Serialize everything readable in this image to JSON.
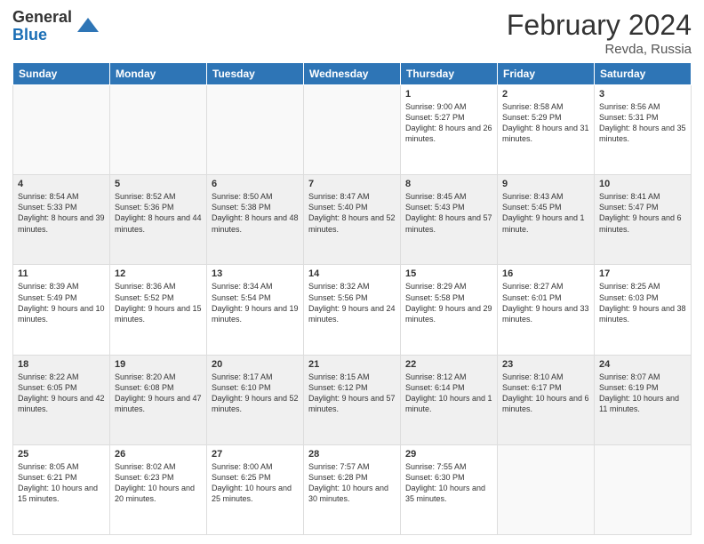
{
  "header": {
    "logo_general": "General",
    "logo_blue": "Blue",
    "month_year": "February 2024",
    "location": "Revda, Russia"
  },
  "days_of_week": [
    "Sunday",
    "Monday",
    "Tuesday",
    "Wednesday",
    "Thursday",
    "Friday",
    "Saturday"
  ],
  "weeks": [
    [
      {
        "day": "",
        "empty": true
      },
      {
        "day": "",
        "empty": true
      },
      {
        "day": "",
        "empty": true
      },
      {
        "day": "",
        "empty": true
      },
      {
        "day": "1",
        "sunrise": "Sunrise: 9:00 AM",
        "sunset": "Sunset: 5:27 PM",
        "daylight": "Daylight: 8 hours and 26 minutes."
      },
      {
        "day": "2",
        "sunrise": "Sunrise: 8:58 AM",
        "sunset": "Sunset: 5:29 PM",
        "daylight": "Daylight: 8 hours and 31 minutes."
      },
      {
        "day": "3",
        "sunrise": "Sunrise: 8:56 AM",
        "sunset": "Sunset: 5:31 PM",
        "daylight": "Daylight: 8 hours and 35 minutes."
      }
    ],
    [
      {
        "day": "4",
        "sunrise": "Sunrise: 8:54 AM",
        "sunset": "Sunset: 5:33 PM",
        "daylight": "Daylight: 8 hours and 39 minutes."
      },
      {
        "day": "5",
        "sunrise": "Sunrise: 8:52 AM",
        "sunset": "Sunset: 5:36 PM",
        "daylight": "Daylight: 8 hours and 44 minutes."
      },
      {
        "day": "6",
        "sunrise": "Sunrise: 8:50 AM",
        "sunset": "Sunset: 5:38 PM",
        "daylight": "Daylight: 8 hours and 48 minutes."
      },
      {
        "day": "7",
        "sunrise": "Sunrise: 8:47 AM",
        "sunset": "Sunset: 5:40 PM",
        "daylight": "Daylight: 8 hours and 52 minutes."
      },
      {
        "day": "8",
        "sunrise": "Sunrise: 8:45 AM",
        "sunset": "Sunset: 5:43 PM",
        "daylight": "Daylight: 8 hours and 57 minutes."
      },
      {
        "day": "9",
        "sunrise": "Sunrise: 8:43 AM",
        "sunset": "Sunset: 5:45 PM",
        "daylight": "Daylight: 9 hours and 1 minute."
      },
      {
        "day": "10",
        "sunrise": "Sunrise: 8:41 AM",
        "sunset": "Sunset: 5:47 PM",
        "daylight": "Daylight: 9 hours and 6 minutes."
      }
    ],
    [
      {
        "day": "11",
        "sunrise": "Sunrise: 8:39 AM",
        "sunset": "Sunset: 5:49 PM",
        "daylight": "Daylight: 9 hours and 10 minutes."
      },
      {
        "day": "12",
        "sunrise": "Sunrise: 8:36 AM",
        "sunset": "Sunset: 5:52 PM",
        "daylight": "Daylight: 9 hours and 15 minutes."
      },
      {
        "day": "13",
        "sunrise": "Sunrise: 8:34 AM",
        "sunset": "Sunset: 5:54 PM",
        "daylight": "Daylight: 9 hours and 19 minutes."
      },
      {
        "day": "14",
        "sunrise": "Sunrise: 8:32 AM",
        "sunset": "Sunset: 5:56 PM",
        "daylight": "Daylight: 9 hours and 24 minutes."
      },
      {
        "day": "15",
        "sunrise": "Sunrise: 8:29 AM",
        "sunset": "Sunset: 5:58 PM",
        "daylight": "Daylight: 9 hours and 29 minutes."
      },
      {
        "day": "16",
        "sunrise": "Sunrise: 8:27 AM",
        "sunset": "Sunset: 6:01 PM",
        "daylight": "Daylight: 9 hours and 33 minutes."
      },
      {
        "day": "17",
        "sunrise": "Sunrise: 8:25 AM",
        "sunset": "Sunset: 6:03 PM",
        "daylight": "Daylight: 9 hours and 38 minutes."
      }
    ],
    [
      {
        "day": "18",
        "sunrise": "Sunrise: 8:22 AM",
        "sunset": "Sunset: 6:05 PM",
        "daylight": "Daylight: 9 hours and 42 minutes."
      },
      {
        "day": "19",
        "sunrise": "Sunrise: 8:20 AM",
        "sunset": "Sunset: 6:08 PM",
        "daylight": "Daylight: 9 hours and 47 minutes."
      },
      {
        "day": "20",
        "sunrise": "Sunrise: 8:17 AM",
        "sunset": "Sunset: 6:10 PM",
        "daylight": "Daylight: 9 hours and 52 minutes."
      },
      {
        "day": "21",
        "sunrise": "Sunrise: 8:15 AM",
        "sunset": "Sunset: 6:12 PM",
        "daylight": "Daylight: 9 hours and 57 minutes."
      },
      {
        "day": "22",
        "sunrise": "Sunrise: 8:12 AM",
        "sunset": "Sunset: 6:14 PM",
        "daylight": "Daylight: 10 hours and 1 minute."
      },
      {
        "day": "23",
        "sunrise": "Sunrise: 8:10 AM",
        "sunset": "Sunset: 6:17 PM",
        "daylight": "Daylight: 10 hours and 6 minutes."
      },
      {
        "day": "24",
        "sunrise": "Sunrise: 8:07 AM",
        "sunset": "Sunset: 6:19 PM",
        "daylight": "Daylight: 10 hours and 11 minutes."
      }
    ],
    [
      {
        "day": "25",
        "sunrise": "Sunrise: 8:05 AM",
        "sunset": "Sunset: 6:21 PM",
        "daylight": "Daylight: 10 hours and 15 minutes."
      },
      {
        "day": "26",
        "sunrise": "Sunrise: 8:02 AM",
        "sunset": "Sunset: 6:23 PM",
        "daylight": "Daylight: 10 hours and 20 minutes."
      },
      {
        "day": "27",
        "sunrise": "Sunrise: 8:00 AM",
        "sunset": "Sunset: 6:25 PM",
        "daylight": "Daylight: 10 hours and 25 minutes."
      },
      {
        "day": "28",
        "sunrise": "Sunrise: 7:57 AM",
        "sunset": "Sunset: 6:28 PM",
        "daylight": "Daylight: 10 hours and 30 minutes."
      },
      {
        "day": "29",
        "sunrise": "Sunrise: 7:55 AM",
        "sunset": "Sunset: 6:30 PM",
        "daylight": "Daylight: 10 hours and 35 minutes."
      },
      {
        "day": "",
        "empty": true
      },
      {
        "day": "",
        "empty": true
      }
    ]
  ]
}
